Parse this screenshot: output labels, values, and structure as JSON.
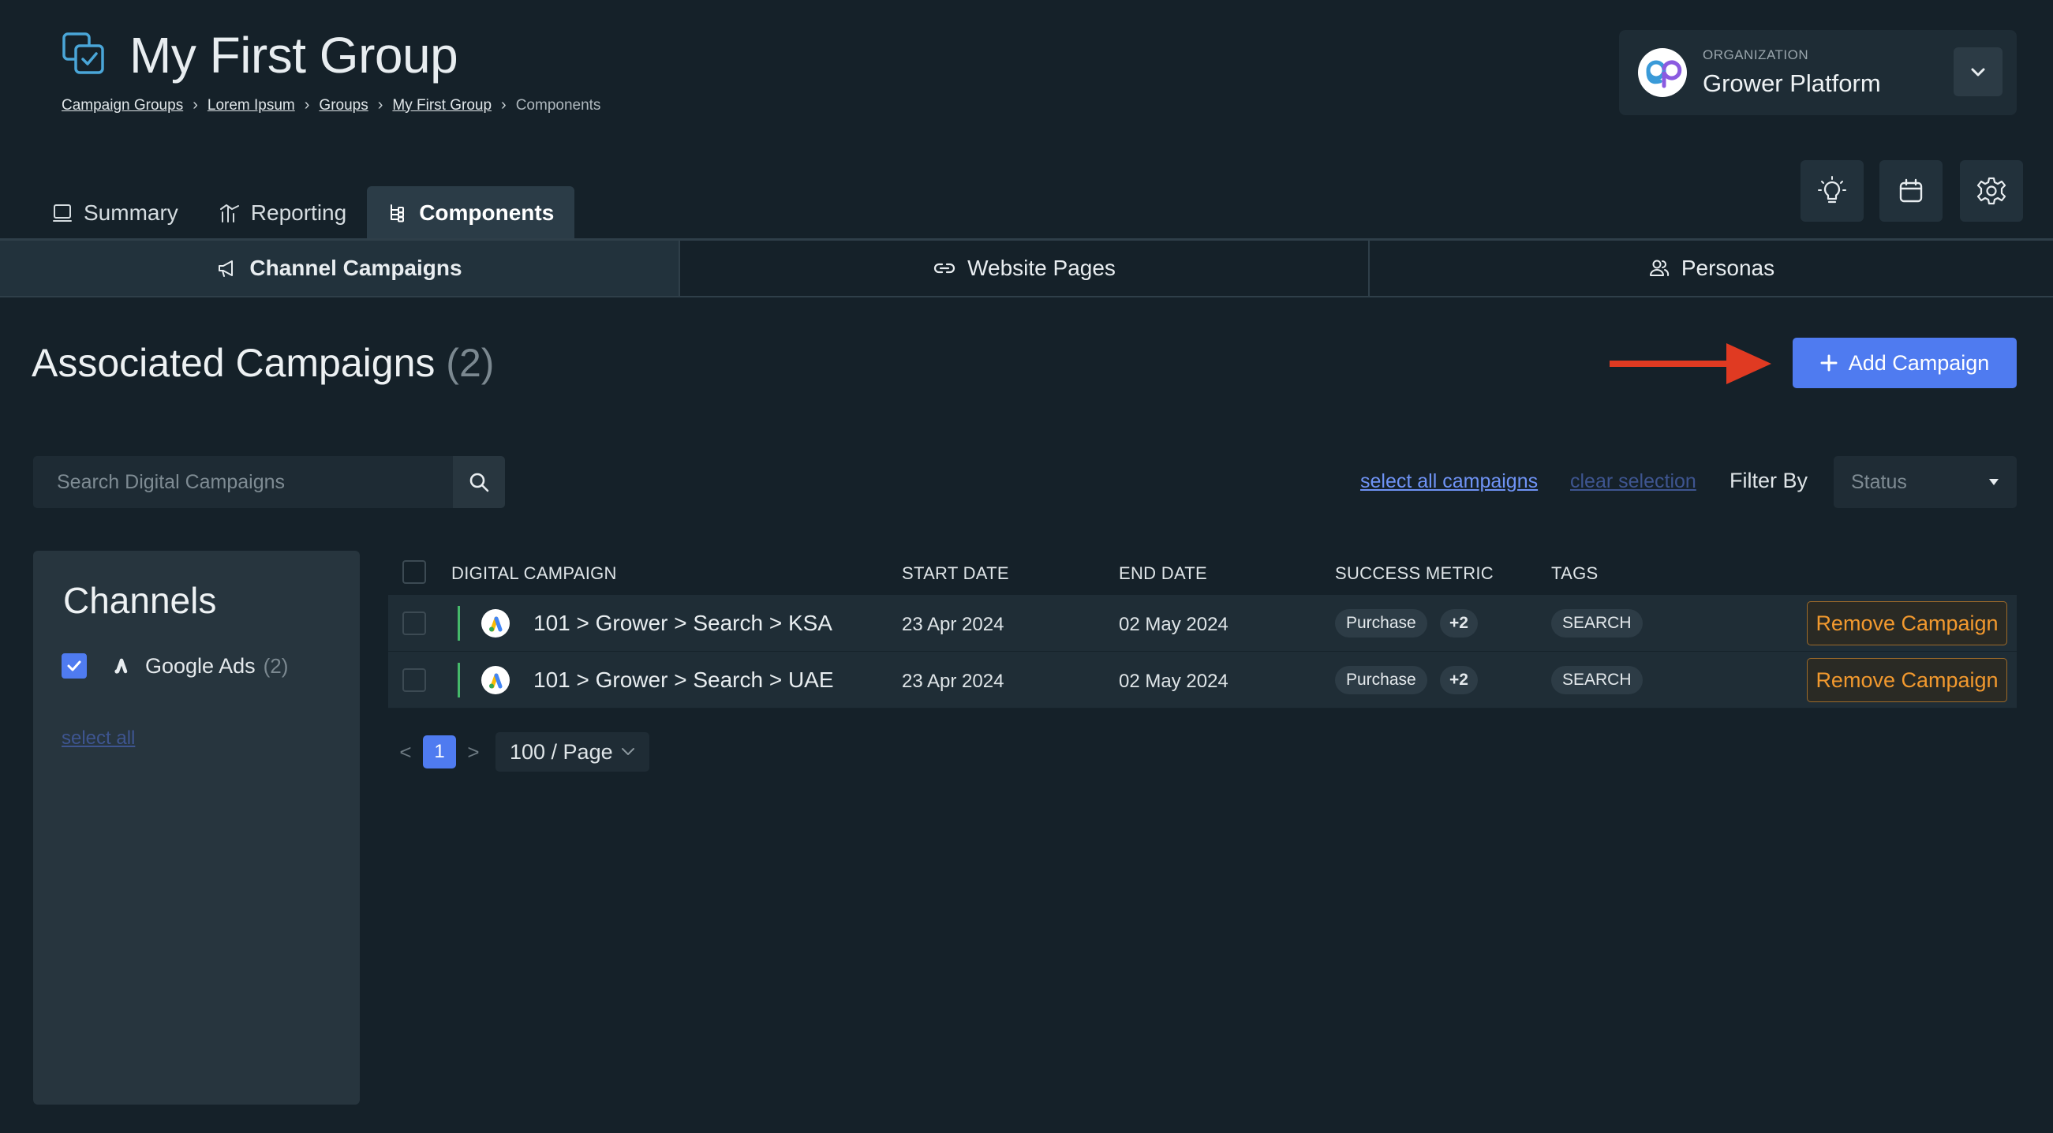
{
  "header": {
    "title": "My First Group",
    "breadcrumb": [
      "Campaign Groups",
      "Lorem Ipsum",
      "Groups",
      "My First Group",
      "Components"
    ],
    "separator": "›"
  },
  "organization": {
    "label": "ORGANIZATION",
    "name": "Grower Platform",
    "logo_text": "gp"
  },
  "toolbar": {
    "icons": [
      "lightbulb-icon",
      "calendar-icon",
      "gear-icon"
    ]
  },
  "tabs": [
    {
      "label": "Summary",
      "icon": "notebook-icon",
      "active": false
    },
    {
      "label": "Reporting",
      "icon": "chart-icon",
      "active": false
    },
    {
      "label": "Components",
      "icon": "tree-icon",
      "active": true
    }
  ],
  "subtabs": [
    {
      "label": "Channel Campaigns",
      "icon": "megaphone-icon",
      "active": true
    },
    {
      "label": "Website Pages",
      "icon": "link-icon",
      "active": false
    },
    {
      "label": "Personas",
      "icon": "users-icon",
      "active": false
    }
  ],
  "section": {
    "title": "Associated Campaigns",
    "count": "(2)",
    "add_label": "Add Campaign"
  },
  "search": {
    "placeholder": "Search Digital Campaigns"
  },
  "filters": {
    "select_all": "select all campaigns",
    "clear": "clear selection",
    "filter_by": "Filter By",
    "status_placeholder": "Status"
  },
  "channels": {
    "title": "Channels",
    "items": [
      {
        "label": "Google Ads",
        "count": "(2)",
        "checked": true
      }
    ],
    "select_all": "select all"
  },
  "table": {
    "columns": [
      "DIGITAL CAMPAIGN",
      "START DATE",
      "END DATE",
      "SUCCESS METRIC",
      "TAGS"
    ],
    "rows": [
      {
        "name": "101 > Grower > Search > KSA",
        "start": "23 Apr 2024",
        "end": "02 May 2024",
        "metric": "Purchase",
        "metric_more": "+2",
        "tag": "SEARCH",
        "action": "Remove Campaign"
      },
      {
        "name": "101 > Grower > Search > UAE",
        "start": "23 Apr 2024",
        "end": "02 May 2024",
        "metric": "Purchase",
        "metric_more": "+2",
        "tag": "SEARCH",
        "action": "Remove Campaign"
      }
    ]
  },
  "pagination": {
    "prev": "<",
    "page": "1",
    "next": ">",
    "page_size": "100 / Page"
  },
  "colors": {
    "background": "#152129",
    "accent": "#4f7bf0",
    "remove": "#f2992e",
    "annotation_arrow": "#e03a22"
  }
}
